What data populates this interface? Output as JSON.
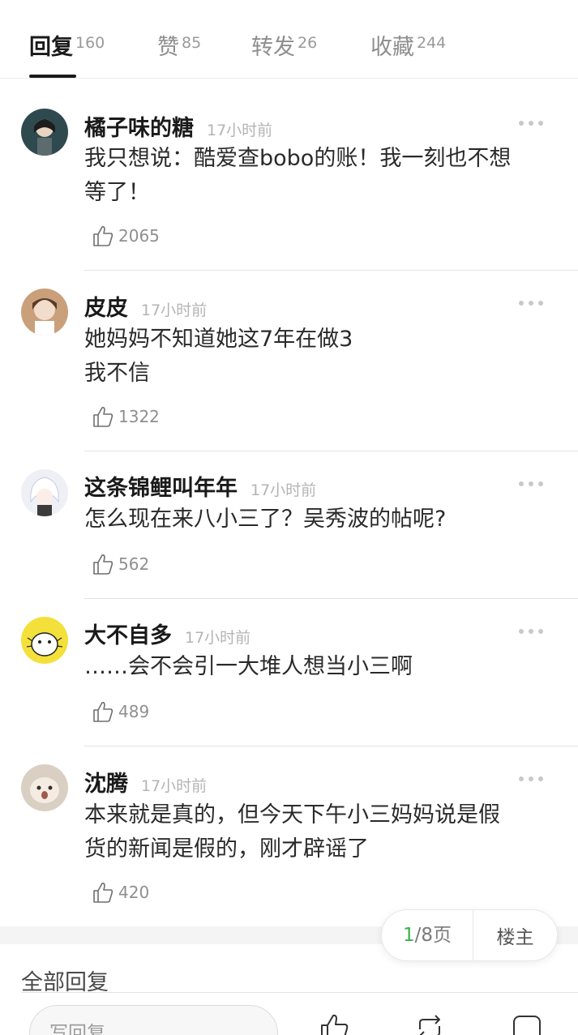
{
  "tabs": [
    {
      "label": "回复",
      "count": "160",
      "active": true
    },
    {
      "label": "赞",
      "count": "85"
    },
    {
      "label": "转发",
      "count": "26"
    },
    {
      "label": "收藏",
      "count": "244"
    }
  ],
  "comments": [
    {
      "name": "橘子味的糖",
      "time": "17小时前",
      "text": "我只想说：酷爱查bobo的账！我一刻也不想\n等了！",
      "likes": "2065"
    },
    {
      "name": "皮皮",
      "time": "17小时前",
      "text": "她妈妈不知道她这7年在做3\n我不信",
      "likes": "1322"
    },
    {
      "name": "这条锦鲤叫年年",
      "time": "17小时前",
      "text": "怎么现在来八小三了？吴秀波的帖呢?",
      "likes": "562"
    },
    {
      "name": "大不自多",
      "time": "17小时前",
      "text": "……会不会引一大堆人想当小三啊",
      "likes": "489"
    },
    {
      "name": "沈腾",
      "time": "17小时前",
      "text": "本来就是真的，但今天下午小三妈妈说是假\n货的新闻是假的，刚才辟谣了",
      "likes": "420"
    }
  ],
  "pager": {
    "current": "1",
    "total": "/8页",
    "owner_label": "楼主"
  },
  "section_title": "全部回复",
  "reply_placeholder": "写回复",
  "icons": {
    "like": "thumb-up-icon",
    "more": "more-dots-icon",
    "repost": "repost-icon",
    "comment": "comment-icon"
  }
}
